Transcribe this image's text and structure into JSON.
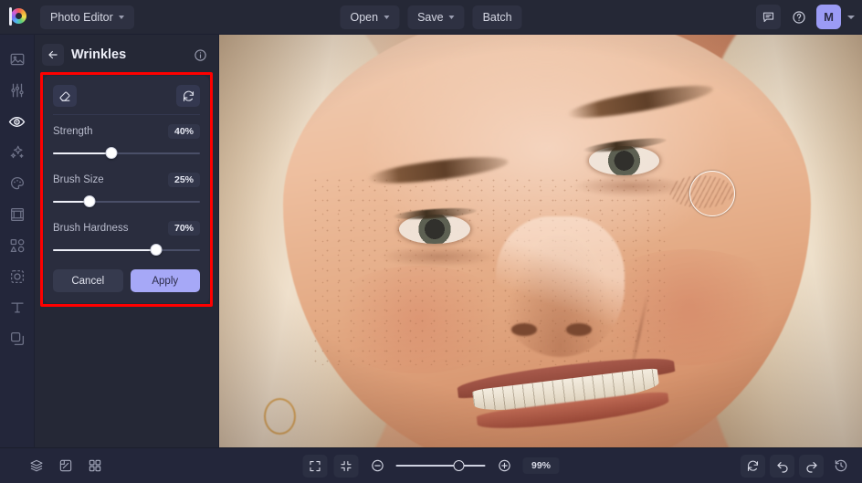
{
  "app": {
    "logo_name": "logo-icon",
    "workspace_label": "Photo Editor"
  },
  "topbar": {
    "open_label": "Open",
    "save_label": "Save",
    "batch_label": "Batch",
    "feedback_icon": "comment-icon",
    "help_icon": "question-circle-icon",
    "avatar_initial": "M"
  },
  "rail": {
    "items": [
      {
        "icon": "image-icon",
        "name": "sidebar-item-image",
        "active": false
      },
      {
        "icon": "adjustments-icon",
        "name": "sidebar-item-adjust",
        "active": false
      },
      {
        "icon": "eye-retouch-icon",
        "name": "sidebar-item-retouch",
        "active": true
      },
      {
        "icon": "sparkle-effects-icon",
        "name": "sidebar-item-effects",
        "active": false
      },
      {
        "icon": "palette-icon",
        "name": "sidebar-item-color",
        "active": false
      },
      {
        "icon": "frame-icon",
        "name": "sidebar-item-frame",
        "active": false
      },
      {
        "icon": "shapes-icon",
        "name": "sidebar-item-shapes",
        "active": false
      },
      {
        "icon": "sticker-icon",
        "name": "sidebar-item-sticker",
        "active": false
      },
      {
        "icon": "text-icon",
        "name": "sidebar-item-text",
        "active": false
      },
      {
        "icon": "layers-icon",
        "name": "sidebar-item-layers",
        "active": false
      }
    ]
  },
  "panel": {
    "back_icon": "arrow-left-icon",
    "title": "Wrinkles",
    "info_icon": "info-circle-icon",
    "eraser_icon": "eraser-icon",
    "reset_icon": "reset-icon",
    "sliders": [
      {
        "label": "Strength",
        "value": "40%",
        "percent": 40
      },
      {
        "label": "Brush Size",
        "value": "25%",
        "percent": 25
      },
      {
        "label": "Brush Hardness",
        "value": "70%",
        "percent": 70
      }
    ],
    "cancel_label": "Cancel",
    "apply_label": "Apply",
    "highlight_color": "#ff0000"
  },
  "canvas": {
    "photo_alt": "close-up portrait of smiling blonde woman",
    "brush_cursor": "brush-cursor"
  },
  "bottombar": {
    "layers_icon": "layers-stack-icon",
    "compare_icon": "compare-icon",
    "grid_icon": "grid-icon",
    "fit_icon": "fit-screen-icon",
    "shrink_icon": "shrink-icon",
    "zoom_out_icon": "zoom-out-icon",
    "zoom_in_icon": "zoom-in-icon",
    "zoom_value": "99%",
    "refresh_icon": "refresh-icon",
    "undo_icon": "undo-icon",
    "redo_icon": "redo-icon",
    "history_icon": "history-icon"
  },
  "colors": {
    "topbar_bg": "#252836",
    "panel_bg": "#252836",
    "card_bg": "#2a2d3e",
    "rail_bg": "#23263a",
    "accent": "#a6a8f7",
    "highlight": "#ff0000"
  }
}
